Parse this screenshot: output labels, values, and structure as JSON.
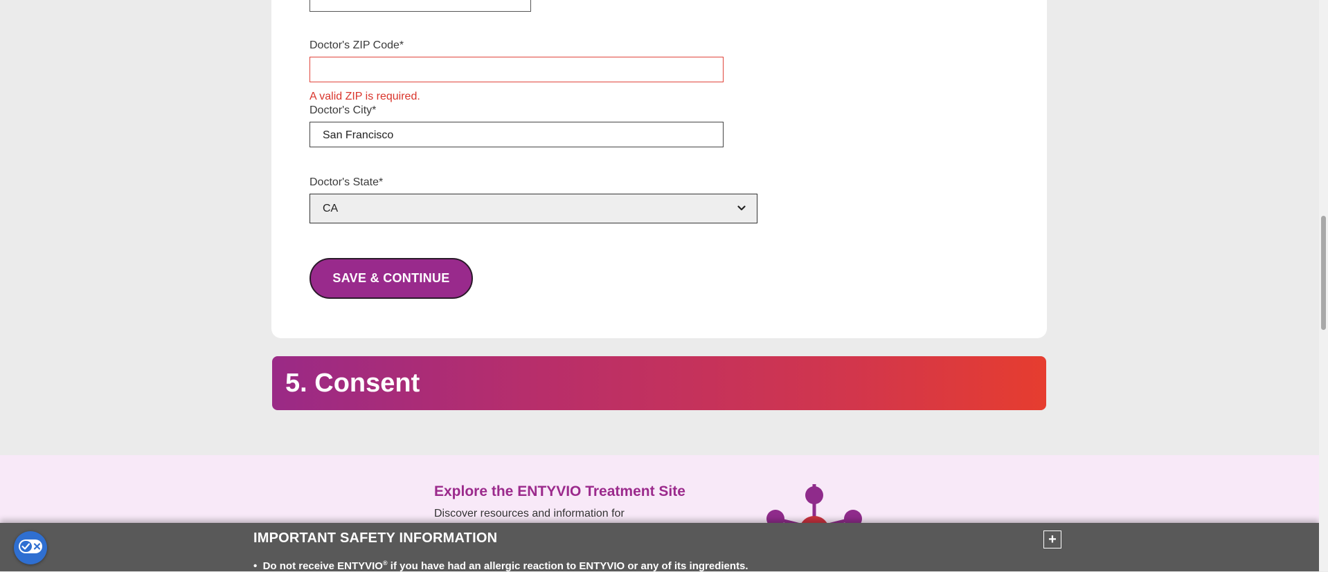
{
  "form": {
    "zip": {
      "label": "Doctor's ZIP Code*",
      "value": "",
      "error": "A valid ZIP is required."
    },
    "city": {
      "label": "Doctor's City*",
      "value": "San Francisco"
    },
    "state": {
      "label": "Doctor's State*",
      "value": "CA"
    },
    "save_label": "SAVE & CONTINUE"
  },
  "consent": {
    "title": "5. Consent"
  },
  "explore": {
    "title": "Explore the ENTYVIO Treatment Site",
    "description": "Discover resources and information for"
  },
  "isi": {
    "title": "IMPORTANT SAFETY INFORMATION",
    "toggle": "+",
    "bullet_prefix": "Do not receive ENTYVIO",
    "bullet_reg": "®",
    "bullet_rest": " if you have had an allergic reaction to ENTYVIO or any of its ingredients."
  },
  "colors": {
    "brand_purple": "#992a8c",
    "error_red": "#d9342b",
    "consent_gradient_start": "#9a2a86",
    "consent_gradient_end": "#e63d2f",
    "isi_background": "#595959"
  },
  "icons": {
    "cookie": "checkmark-x-toggle-icon",
    "select_arrow": "chevron-down-icon",
    "molecule": "molecule-graphic-icon"
  }
}
